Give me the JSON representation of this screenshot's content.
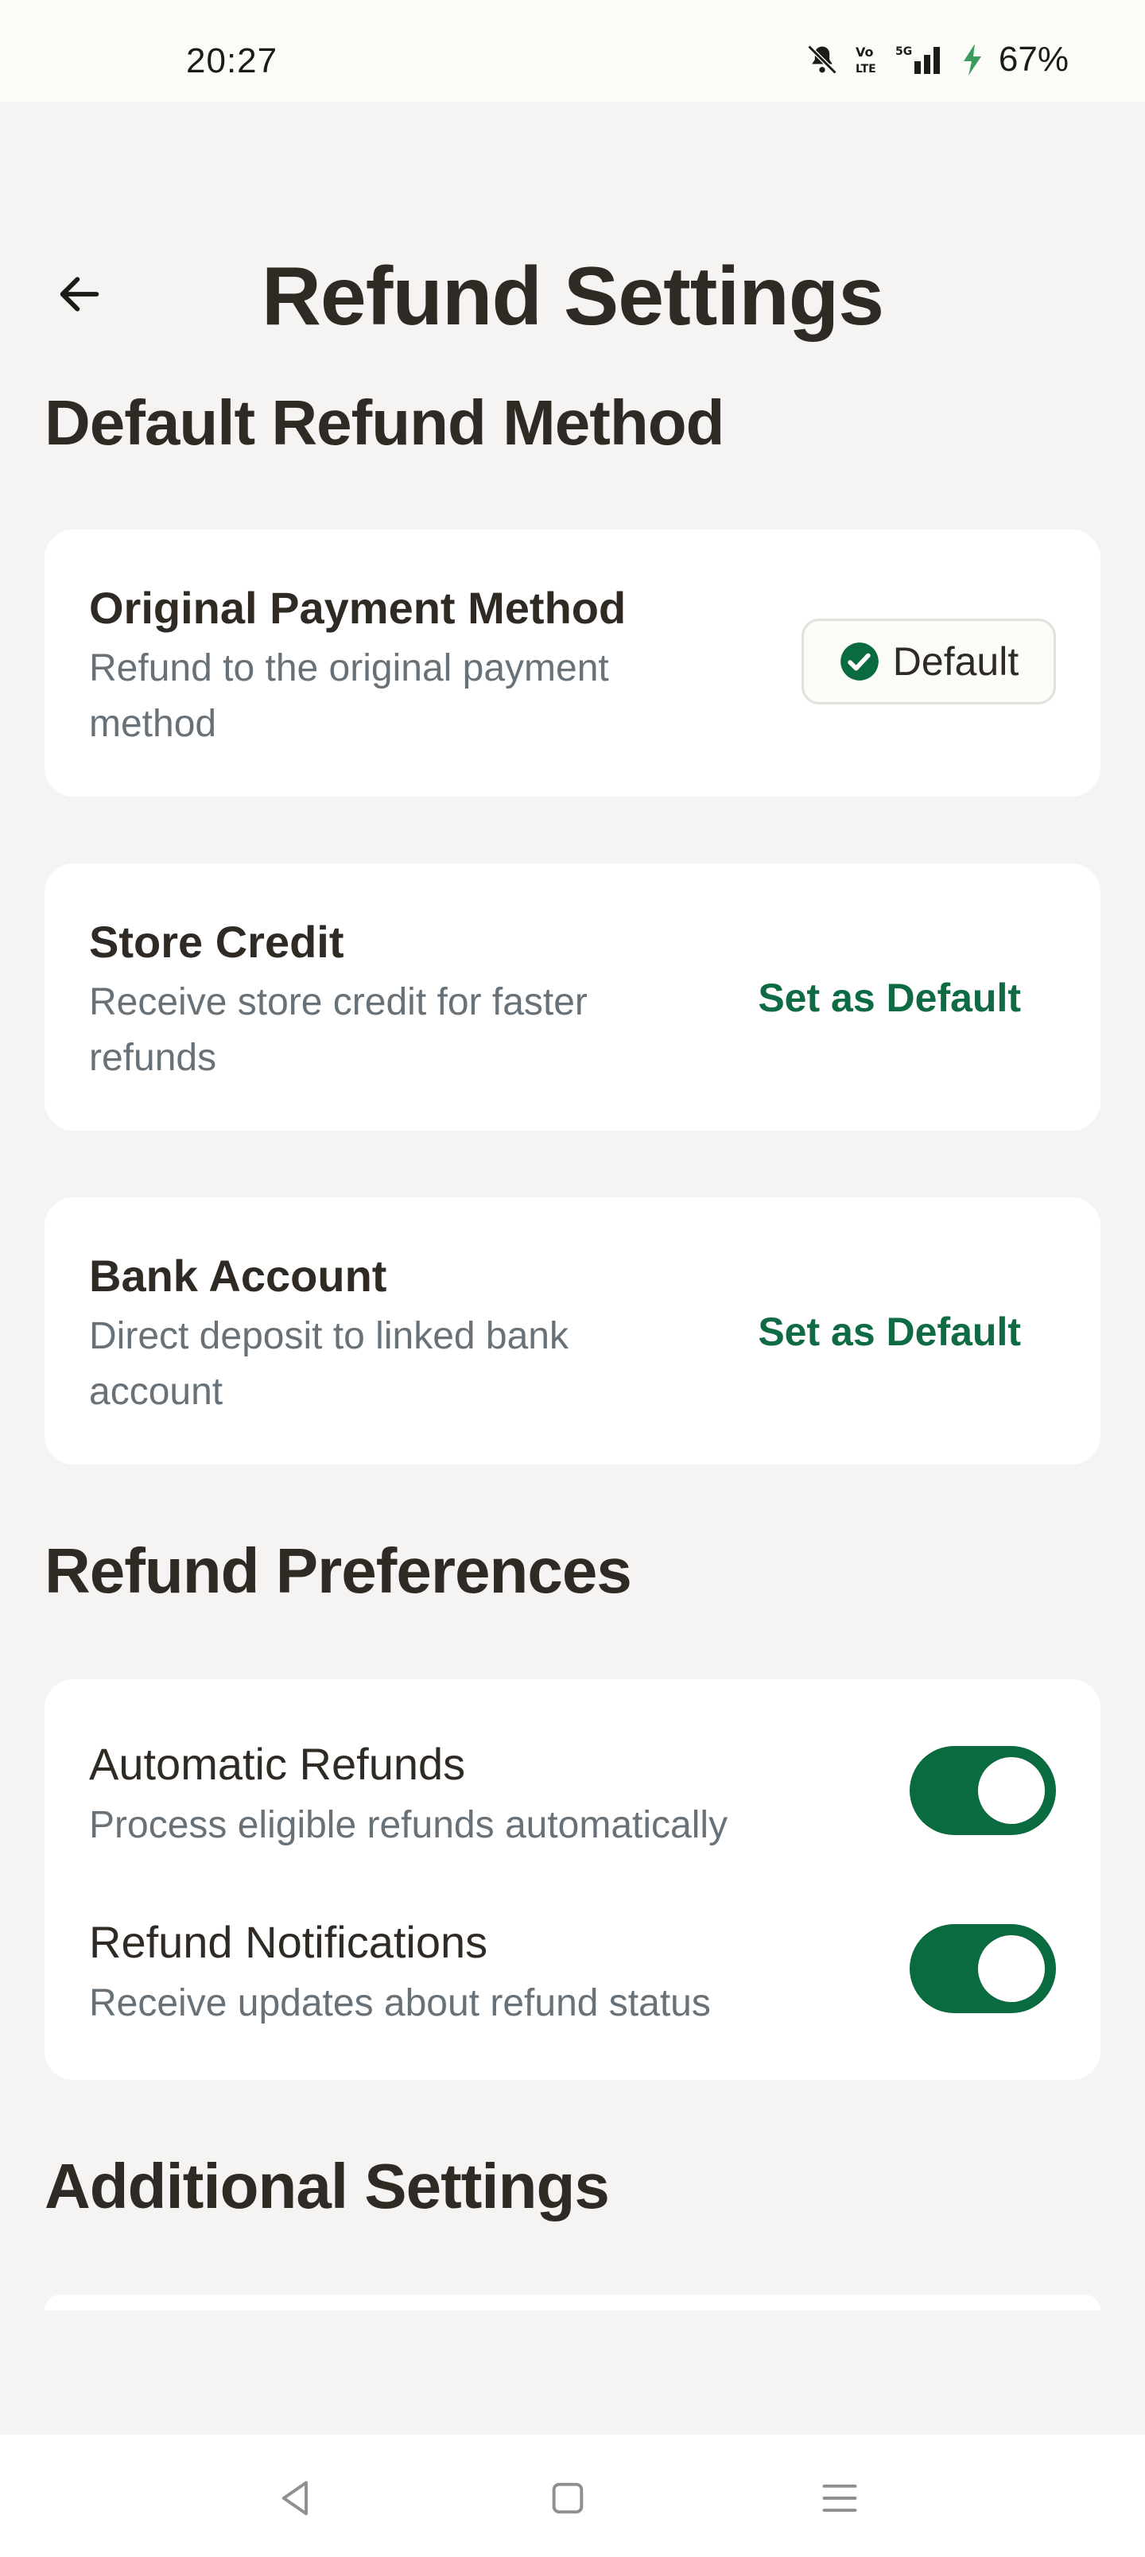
{
  "status_bar": {
    "time": "20:27",
    "battery": "67%",
    "icons": [
      "bell-muted-icon",
      "volte-icon",
      "5g-signal-icon",
      "charging-icon"
    ]
  },
  "header": {
    "title": "Refund Settings",
    "back_icon": "arrow-left-icon"
  },
  "sections": {
    "default_method": "Default Refund Method",
    "preferences": "Refund Preferences",
    "additional": "Additional Settings"
  },
  "methods": [
    {
      "title": "Original Payment Method",
      "desc": "Refund to the original payment method",
      "action": "Default",
      "is_default": true
    },
    {
      "title": "Store Credit",
      "desc": "Receive store credit for faster refunds",
      "action": "Set as Default",
      "is_default": false
    },
    {
      "title": "Bank Account",
      "desc": "Direct deposit to linked bank account",
      "action": "Set as Default",
      "is_default": false
    }
  ],
  "preferences": [
    {
      "title": "Automatic Refunds",
      "desc": "Process eligible refunds automatically",
      "enabled": true
    },
    {
      "title": "Refund Notifications",
      "desc": "Receive updates about refund status",
      "enabled": true
    }
  ],
  "colors": {
    "accent": "#0a6a40",
    "background": "#f5f4f2",
    "card": "#ffffff",
    "text": "#2f2a24",
    "muted": "#687177"
  },
  "nav_bar": {
    "icons": [
      "back-triangle-icon",
      "home-square-icon",
      "menu-lines-icon"
    ]
  }
}
